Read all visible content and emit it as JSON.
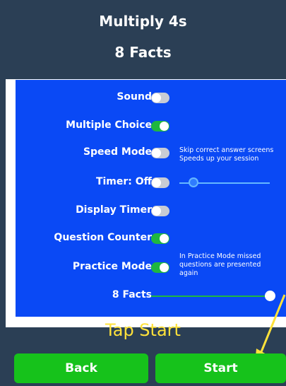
{
  "header": {
    "title": "Multiply 4s",
    "subtitle": "8 Facts"
  },
  "settings": {
    "sound": {
      "label": "Sound",
      "on": false
    },
    "multiple_choice": {
      "label": "Multiple Choice",
      "on": true
    },
    "speed_mode": {
      "label": "Speed Mode",
      "on": false,
      "hint_line1": "Skip correct answer screens",
      "hint_line2": "Speeds up your session"
    },
    "timer": {
      "label": "Timer:  Off",
      "on": false,
      "slider_value": 0.16
    },
    "display_timer": {
      "label": "Display Timer",
      "on": false
    },
    "question_counter": {
      "label": "Question Counter",
      "on": true
    },
    "practice_mode": {
      "label": "Practice Mode",
      "on": true,
      "hint_line1": "In Practice Mode missed",
      "hint_line2": "questions are presented",
      "hint_line3": "again"
    },
    "facts": {
      "label": "8 Facts",
      "slider_value": 1.0
    }
  },
  "annotation": {
    "text": "Tap Start",
    "color": "#ffe23a"
  },
  "buttons": {
    "back": "Back",
    "start": "Start"
  },
  "colors": {
    "background": "#2b3f55",
    "panel": "#0a49f5",
    "toggle_on": "#1fb740",
    "toggle_off": "#c8ccd4",
    "button": "#16c21b"
  }
}
